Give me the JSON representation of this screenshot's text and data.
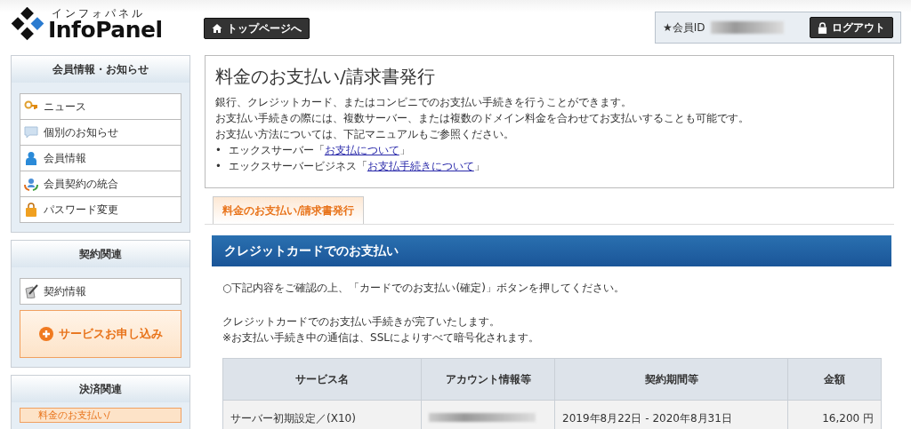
{
  "logo": {
    "kana": "インフォパネル",
    "name": "InfoPanel"
  },
  "top_button": "トップページへ",
  "member": {
    "label": "★会員ID",
    "logout": "ログアウト"
  },
  "sidebar": [
    {
      "title": "会員情報・お知らせ",
      "items": [
        {
          "label": "ニュース",
          "kind": "link"
        },
        {
          "label": "個別のお知らせ",
          "kind": "link"
        },
        {
          "label": "会員情報",
          "kind": "link"
        },
        {
          "label": "会員契約の統合",
          "kind": "link"
        },
        {
          "label": "パスワード変更",
          "kind": "link"
        }
      ]
    },
    {
      "title": "契約関連",
      "items": [
        {
          "label": "契約情報",
          "kind": "link"
        },
        {
          "label": "サービスお申し込み",
          "kind": "action"
        }
      ]
    },
    {
      "title": "決済関連",
      "items": [
        {
          "label": "料金のお支払い/",
          "kind": "current"
        }
      ]
    }
  ],
  "page": {
    "title": "料金のお支払い/請求書発行",
    "lines": [
      "銀行、クレジットカード、またはコンビニでのお支払い手続きを行うことができます。",
      "お支払い手続きの際には、複数サーバー、または複数のドメイン料金を合わせてお支払いすることも可能です。",
      "お支払い方法については、下記マニュアルもご参照ください。"
    ],
    "bullets": [
      {
        "marker": "•",
        "prefix": "エックスサーバー「",
        "link": "お支払について",
        "suffix": "」"
      },
      {
        "marker": "•",
        "prefix": "エックスサーバービジネス「",
        "link": "お支払手続きについて",
        "suffix": "」"
      }
    ]
  },
  "tabs": [
    {
      "label": "料金のお支払い/請求書発行",
      "selected": true
    }
  ],
  "section": {
    "title": "クレジットカードでのお支払い",
    "instruction": "○下記内容をご確認の上、「カードでのお支払い(確定)」ボタンを押してください。",
    "notes": [
      "クレジットカードでのお支払い手続きが完了いたします。",
      "※お支払い手続き中の通信は、SSLによりすべて暗号化されます。"
    ]
  },
  "table": {
    "columns": [
      "サービス名",
      "アカウント情報等",
      "契約期間等",
      "金額"
    ],
    "rows": [
      {
        "service": "サーバー初期設定／(X10)",
        "period": "2019年8月22日 - 2020年8月31日",
        "amount": "16,200 円"
      }
    ]
  }
}
